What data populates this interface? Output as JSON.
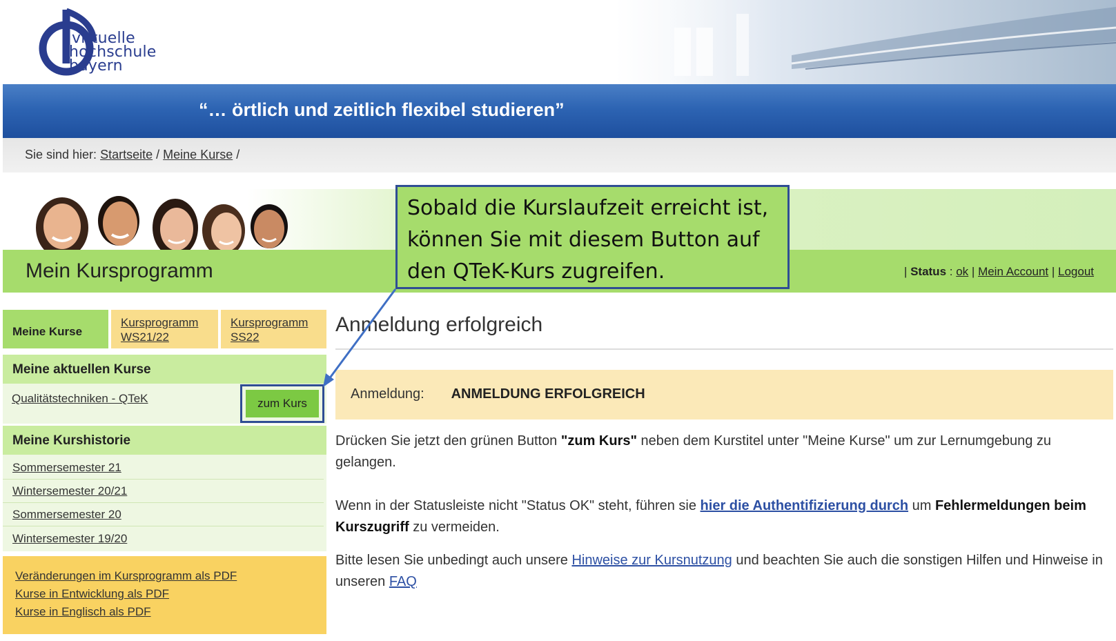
{
  "header": {
    "logo_lines": [
      "virtuelle",
      "hochschule",
      "bayern"
    ],
    "slogan": "“… örtlich und zeitlich flexibel studieren”"
  },
  "breadcrumb": {
    "prefix": "Sie sind hier:",
    "items": [
      "Startseite",
      "Meine Kurse"
    ],
    "separator": "/"
  },
  "program": {
    "title": "Mein Kursprogramm",
    "status_label": "Status",
    "status_value": "ok",
    "account_link": "Mein Account",
    "logout_link": "Logout"
  },
  "callout": {
    "lines": [
      "Sobald die Kurslaufzeit erreicht ist,",
      "können Sie mit diesem Button auf",
      "den QTeK-Kurs zugreifen."
    ]
  },
  "tabs": {
    "active": "Meine Kurse",
    "items": [
      {
        "line1": "Kursprogramm",
        "line2": "WS21/22"
      },
      {
        "line1": "Kursprogramm",
        "line2": "SS22"
      }
    ]
  },
  "current_courses": {
    "heading": "Meine aktuellen Kurse",
    "course_name": "Qualitätstechniken - QTeK",
    "button_label": "zum Kurs"
  },
  "history": {
    "heading": "Meine Kurshistorie",
    "items": [
      "Sommersemester 21",
      "Wintersemester 20/21",
      "Sommersemester 20",
      "Wintersemester 19/20"
    ]
  },
  "pdf_links": [
    "Veränderungen im Kursprogramm als PDF",
    "Kurse in Entwicklung als PDF",
    "Kurse in Englisch als PDF"
  ],
  "main": {
    "title": "Anmeldung erfolgreich",
    "notice_label": "Anmeldung:",
    "notice_value": "ANMELDUNG ERFOLGREICH",
    "p1_a": "Drücken Sie jetzt den grünen Button ",
    "p1_b": "\"zum Kurs\"",
    "p1_c": " neben dem Kurstitel unter \"Meine Kurse\" um zur Lernumgebung zu gelangen.",
    "p2_a": "Wenn in der Statusleiste nicht \"Status OK\" steht, führen sie ",
    "p2_link": "hier die Authentifizierung durch",
    "p2_b": " um ",
    "p2_c": "Fehlermeldungen beim Kurszugriff",
    "p2_d": " zu vermeiden.",
    "p3_a": "Bitte lesen Sie unbedingt auch unsere ",
    "p3_link": "Hinweise zur Kursnutzung",
    "p3_b": " und beachten Sie auch die sonstigen Hilfen und Hinweise in unseren ",
    "p3_link2": "FAQ"
  },
  "colors": {
    "brand_blue": "#2d64b3",
    "green": "#a6dc6c",
    "button_green": "#7cc943",
    "yellow": "#f9dd8c",
    "notice_bg": "#fbe9b8"
  }
}
